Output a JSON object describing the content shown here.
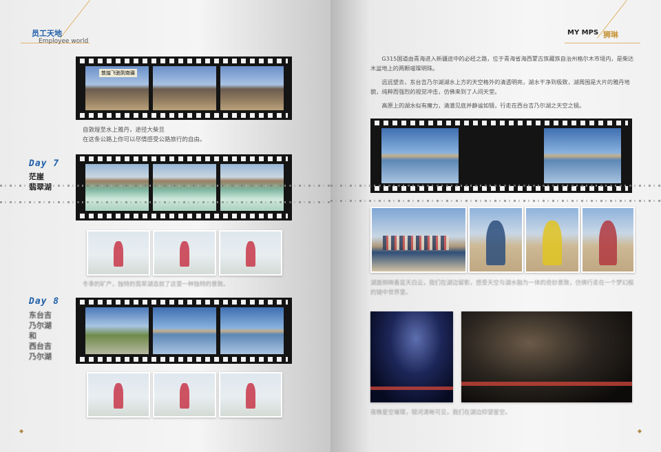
{
  "left": {
    "header_title": "员工天地",
    "header_sub": "Employee world",
    "stamp_text": "敦煌飞驰到南疆",
    "caption1_line1": "自敦煌至水上雅丹，途径大柴旦",
    "caption1_line2": "在这条公路上你可以尽情感受公路旅行的自由。",
    "day7_label": "Day 7",
    "day7_place_line1": "茫崖",
    "day7_place_line2": "翡翠湖",
    "caption2": "冬季的矿产，独特的翡翠湖造就了这里一种独特的景致。",
    "day8_label": "Day 8",
    "day8_place_lines": [
      "东台吉",
      "乃尔湖",
      "和",
      "西台吉",
      "乃尔湖"
    ]
  },
  "right": {
    "brand": "MY MPS",
    "brand_cn": "狮琳",
    "para1": "G315国道由青海进入新疆途中的必经之路，位于青海省海西蒙古族藏族自治州格尔木市境内，是柴达木盆地上的两颗璀璨明珠。",
    "para2": "远远望去，东台吉乃尔湖湖水上方的天空格外的清透明亮，湖水干净到极致，湖周围是大片的雅丹地貌，纯粹而强烈的视觉冲击，仿佛来到了人间天堂。",
    "para3": "高原上的湖水似有魔力，清澈见底并静谧如镜，行走在西台吉乃尔湖之天空之镜。",
    "caption_people": "湖面倒映着蓝天白云，我们在湖边留影，感受天空与湖水融为一体的奇妙景致，仿佛行走在一个梦幻般的镜中世界里。",
    "caption_night": "夜晚星空璀璨，银河清晰可见，我们在湖边仰望星空。"
  }
}
